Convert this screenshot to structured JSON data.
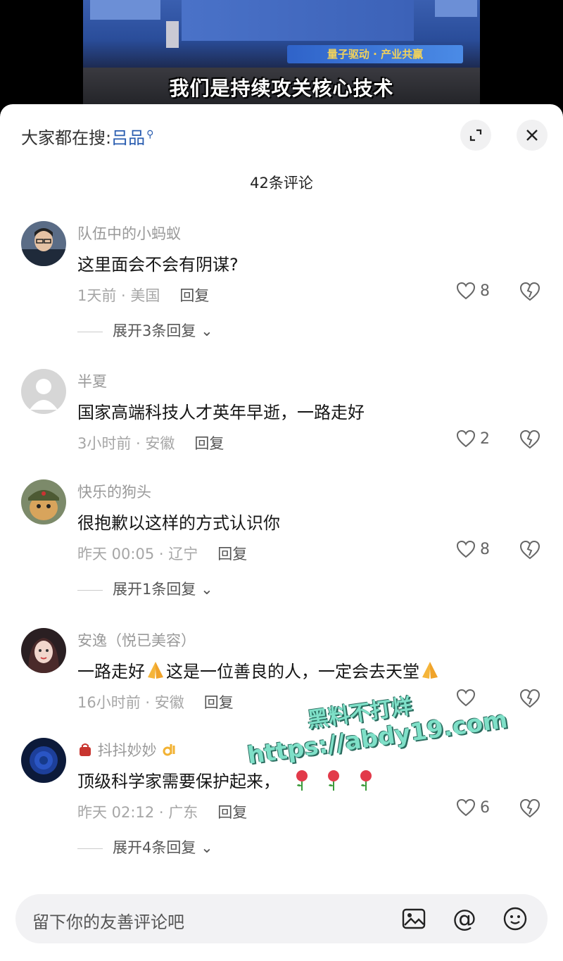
{
  "video": {
    "banner": "量子驱动 · 产业共赢",
    "subtitle": "我们是持续攻关核心技术"
  },
  "header": {
    "search_prefix": "大家都在搜:",
    "search_term": "吕品",
    "comments_count": "42条评论"
  },
  "comments": [
    {
      "username": "队伍中的小蚂蚁",
      "text": "这里面会不会有阴谋?",
      "meta": "1天前 · 美国",
      "reply": "回复",
      "likes": "8",
      "expand": "展开3条回复"
    },
    {
      "username": "半夏",
      "text": "国家高端科技人才英年早逝，一路走好",
      "meta": "3小时前 · 安徽",
      "reply": "回复",
      "likes": "2"
    },
    {
      "username": "快乐的狗头",
      "text": "很抱歉以这样的方式认识你",
      "meta": "昨天 00:05 · 辽宁",
      "reply": "回复",
      "likes": "8",
      "expand": "展开1条回复"
    },
    {
      "username": "安逸（悦已美容）",
      "text_a": "一路走好",
      "text_b": "这是一位善良的人，一定会去天堂",
      "meta": "16小时前 · 安徽",
      "reply": "回复",
      "likes": ""
    },
    {
      "username": "抖抖妙妙",
      "text": "顶级科学家需要保护起来，",
      "meta": "昨天 02:12 · 广东",
      "reply": "回复",
      "likes": "6",
      "expand": "展开4条回复"
    }
  ],
  "watermark": {
    "line1": "黑料不打烊",
    "line2": "https://abdy19.com"
  },
  "input": {
    "placeholder": "留下你的友善评论吧"
  },
  "icons": [
    "search-icon",
    "expand-icon",
    "close-icon",
    "heart-icon",
    "dislike-heart-icon",
    "chevron-down-icon",
    "image-icon",
    "at-icon",
    "emoji-icon"
  ]
}
